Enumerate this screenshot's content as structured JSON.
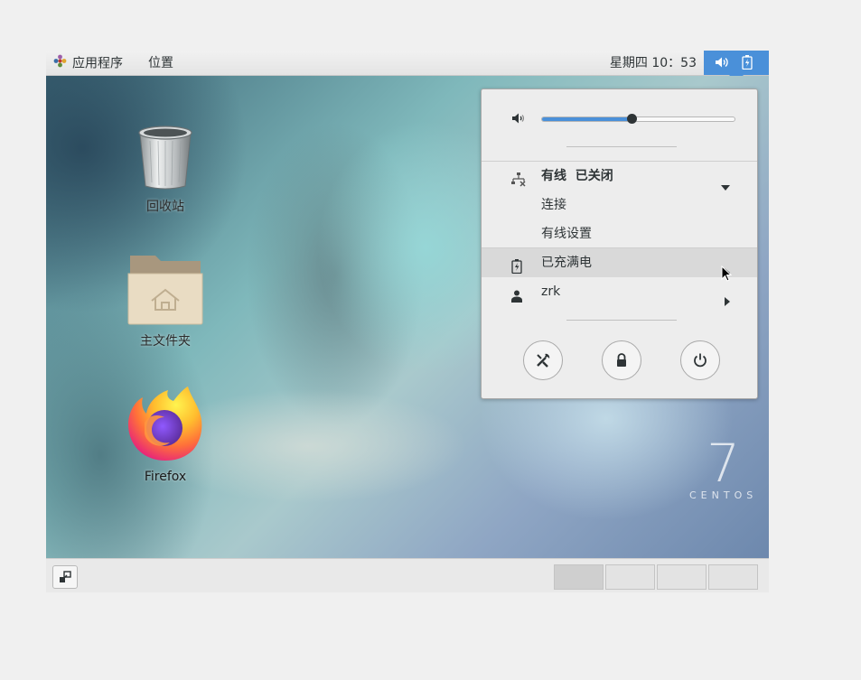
{
  "topbar": {
    "applications_label": "应用程序",
    "places_label": "位置",
    "clock": "星期四 10：53",
    "icons": [
      "apps-icon",
      "volume-icon",
      "battery-icon"
    ]
  },
  "desktop": {
    "icons": [
      {
        "label": "回收站",
        "icon": "trash-icon"
      },
      {
        "label": "主文件夹",
        "icon": "home-folder-icon"
      },
      {
        "label": "Firefox",
        "icon": "firefox-icon"
      }
    ],
    "logo": {
      "number": "7",
      "word": "CENTOS"
    }
  },
  "popup": {
    "volume_level": 0.47,
    "wired": {
      "title": "有线  已关闭",
      "items": [
        "连接",
        "有线设置"
      ]
    },
    "battery_label": "已充满电",
    "user_label": "zrk",
    "buttons": [
      "settings-icon",
      "lock-icon",
      "power-icon"
    ]
  },
  "bottombar": {
    "workspace_count": 4,
    "active_workspace": 1
  },
  "colors": {
    "accent": "#4a90d9",
    "panel_bg": "#ededed"
  }
}
